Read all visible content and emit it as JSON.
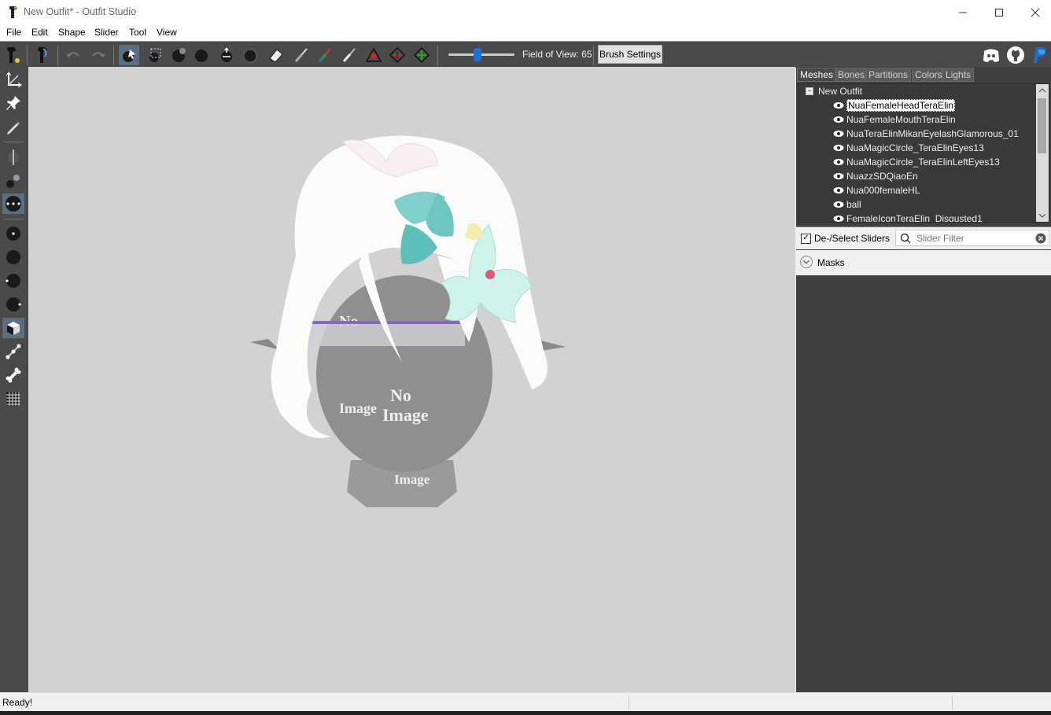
{
  "window": {
    "title": "New Outfit* - Outfit Studio",
    "controls": [
      "minimize-icon",
      "maximize-icon",
      "close-icon"
    ]
  },
  "menu": [
    "File",
    "Edit",
    "Shape",
    "Slider",
    "Tool",
    "View"
  ],
  "toolbar": {
    "fov_label": "Field of View: 65",
    "fov_value": 65,
    "brush_settings_label": "Brush Settings",
    "right_icons": [
      "discord-icon",
      "github-icon",
      "paypal-icon"
    ]
  },
  "right_panel": {
    "tabs": [
      "Meshes",
      "Bones",
      "Partitions",
      "Colors",
      "Lights"
    ],
    "active_tab": "Meshes",
    "tree_root": "New Outfit",
    "meshes": [
      "NuaFemaleHeadTeraElin",
      "NuaFemaleMouthTeraElin",
      "NuaTeraElinMikanEyelashGlamorous_01",
      "NuaMagicCircle_TeraElinEyes13",
      "NuaMagicCircle_TeraElinLeftEyes13",
      "NuazzSDQiaoEn",
      "Nua000femaleHL",
      "ball",
      "FemaleIconTeraElin_Disgusted1"
    ],
    "selected_mesh": "NuaFemaleHeadTeraElin",
    "deselect_sliders_label": "De-/Select Sliders",
    "slider_filter_placeholder": "Slider Filter",
    "masks_label": "Masks"
  },
  "viewport": {
    "texture_text": [
      "No",
      "Image"
    ]
  },
  "status": {
    "text": "Ready!"
  },
  "colors": {
    "toolbar_bg": "#4a4a4a",
    "viewport_bg": "#d2d2d2",
    "accent": "#1f6fd6",
    "active_tool": "#5b6f83"
  }
}
